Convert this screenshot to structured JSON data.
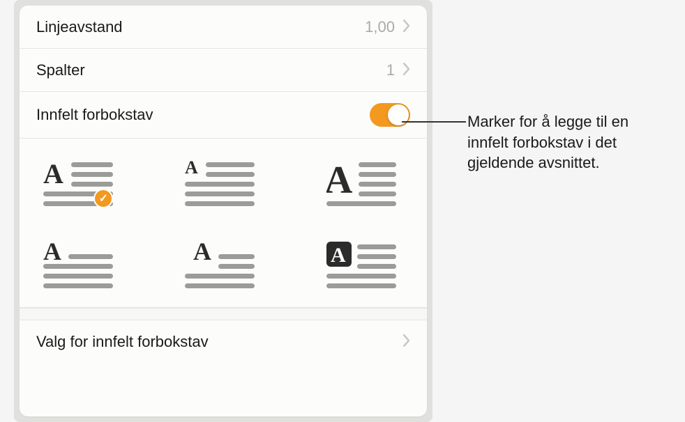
{
  "rows": {
    "line_spacing": {
      "label": "Linjeavstand",
      "value": "1,00"
    },
    "columns": {
      "label": "Spalter",
      "value": "1"
    },
    "drop_cap": {
      "label": "Innfelt forbokstav"
    },
    "options": {
      "label": "Valg for innfelt forbokstav"
    }
  },
  "callout": {
    "text": "Marker for å legge til en innfelt forbokstav i det gjeldende avsnittet."
  },
  "styles": {
    "selected_index": 0
  }
}
